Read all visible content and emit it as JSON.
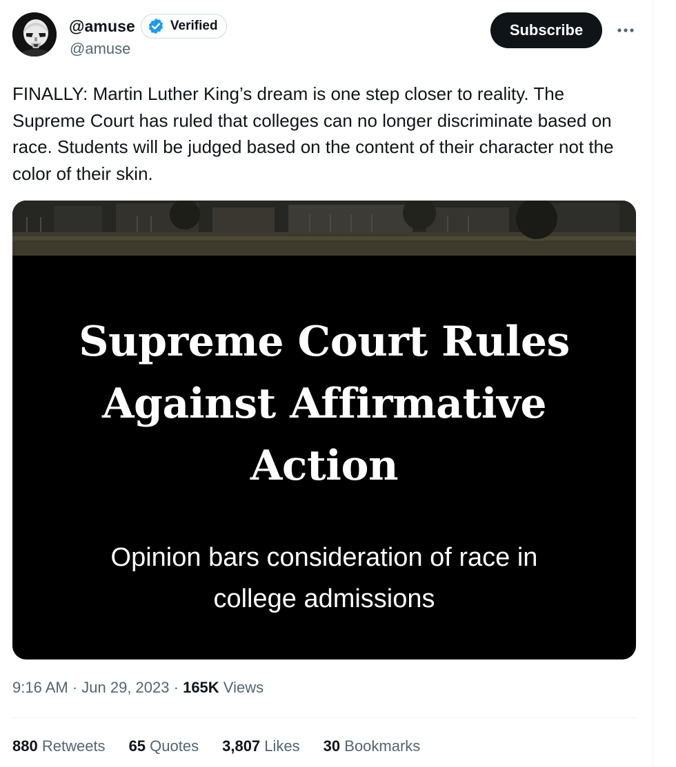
{
  "author": {
    "display_name": "@amuse",
    "username": "@amuse",
    "verified_label": "Verified"
  },
  "actions": {
    "subscribe_label": "Subscribe",
    "more_label": "···"
  },
  "tweet": {
    "text": "FINALLY: Martin Luther King’s dream is one step closer to reality. The Supreme Court has ruled that colleges can no longer discriminate based on race. Students will be judged based on the content of their character not the color of their skin."
  },
  "media": {
    "headline_lines": [
      "Supreme Court Rules",
      "Against Affirmative",
      "Action"
    ],
    "subhead_lines": [
      "Opinion bars consideration of race in",
      "college admissions"
    ]
  },
  "meta": {
    "time": "9:16 AM",
    "separator": " · ",
    "date": "Jun 29, 2023",
    "views_count": "165K",
    "views_label": "Views"
  },
  "stats": [
    {
      "count": "880",
      "label": "Retweets"
    },
    {
      "count": "65",
      "label": "Quotes"
    },
    {
      "count": "3,807",
      "label": "Likes"
    },
    {
      "count": "30",
      "label": "Bookmarks"
    }
  ],
  "colors": {
    "text_primary": "#0f1419",
    "text_secondary": "#536471",
    "verified_blue": "#1d9bf0",
    "button_dark": "#0f1419",
    "divider": "#eff3f4"
  },
  "icons": {
    "avatar": "stormtrooper-avatar",
    "verified": "verified-badge-icon",
    "more": "more-dots-icon"
  }
}
